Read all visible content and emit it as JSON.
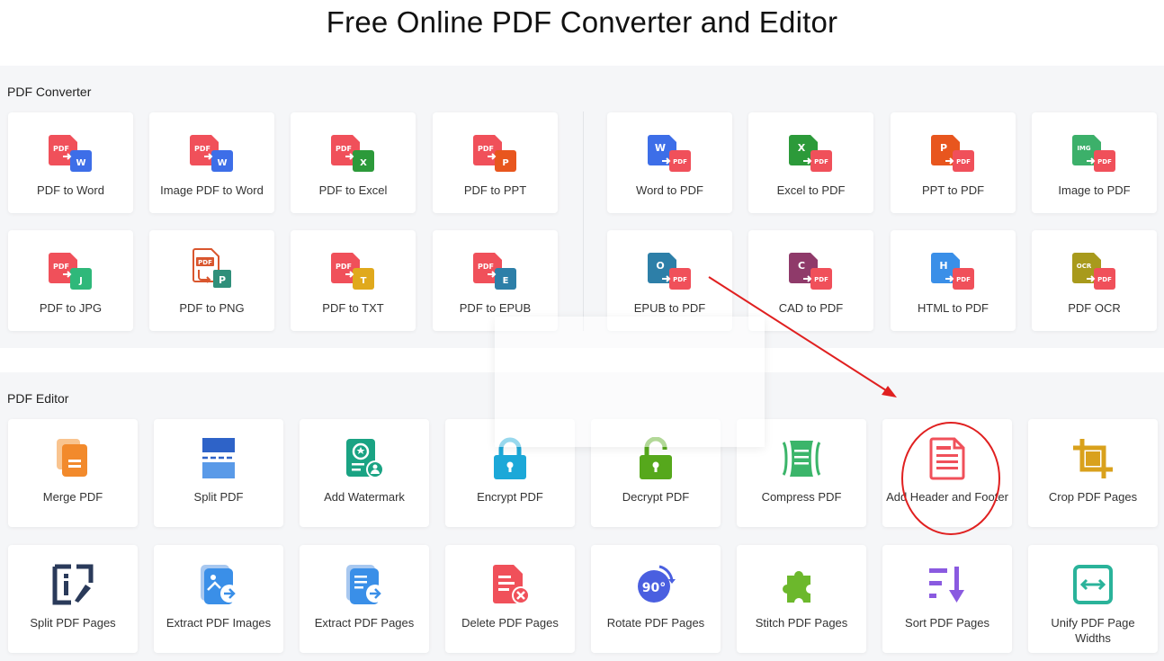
{
  "page": {
    "title": "Free Online PDF Converter and Editor"
  },
  "converter": {
    "section_title": "PDF Converter",
    "tools": [
      {
        "label": "PDF to Word",
        "icon": "pdf-to-word-icon"
      },
      {
        "label": "Image PDF to Word",
        "icon": "image-pdf-to-word-icon"
      },
      {
        "label": "PDF to Excel",
        "icon": "pdf-to-excel-icon"
      },
      {
        "label": "PDF to PPT",
        "icon": "pdf-to-ppt-icon"
      },
      {
        "label": "Word to PDF",
        "icon": "word-to-pdf-icon"
      },
      {
        "label": "Excel to PDF",
        "icon": "excel-to-pdf-icon"
      },
      {
        "label": "PPT to PDF",
        "icon": "ppt-to-pdf-icon"
      },
      {
        "label": "Image to PDF",
        "icon": "image-to-pdf-icon"
      },
      {
        "label": "PDF to JPG",
        "icon": "pdf-to-jpg-icon"
      },
      {
        "label": "PDF to PNG",
        "icon": "pdf-to-png-icon"
      },
      {
        "label": "PDF to TXT",
        "icon": "pdf-to-txt-icon"
      },
      {
        "label": "PDF to EPUB",
        "icon": "pdf-to-epub-icon"
      },
      {
        "label": "EPUB to PDF",
        "icon": "epub-to-pdf-icon"
      },
      {
        "label": "CAD to PDF",
        "icon": "cad-to-pdf-icon"
      },
      {
        "label": "HTML to PDF",
        "icon": "html-to-pdf-icon"
      },
      {
        "label": "PDF OCR",
        "icon": "pdf-ocr-icon"
      }
    ]
  },
  "editor": {
    "section_title": "PDF Editor",
    "tools": [
      {
        "label": "Merge PDF",
        "icon": "merge-pdf-icon"
      },
      {
        "label": "Split PDF",
        "icon": "split-pdf-icon"
      },
      {
        "label": "Add Watermark",
        "icon": "add-watermark-icon"
      },
      {
        "label": "Encrypt PDF",
        "icon": "lock-icon"
      },
      {
        "label": "Decrypt PDF",
        "icon": "unlock-icon"
      },
      {
        "label": "Compress PDF",
        "icon": "compress-pdf-icon"
      },
      {
        "label": "Add Header and Footer",
        "icon": "header-footer-icon"
      },
      {
        "label": "Crop PDF Pages",
        "icon": "crop-icon"
      },
      {
        "label": "Split PDF Pages",
        "icon": "split-pages-icon"
      },
      {
        "label": "Extract PDF Images",
        "icon": "extract-images-icon"
      },
      {
        "label": "Extract PDF Pages",
        "icon": "extract-pages-icon"
      },
      {
        "label": "Delete PDF Pages",
        "icon": "delete-pages-icon"
      },
      {
        "label": "Rotate PDF Pages",
        "icon": "rotate-icon"
      },
      {
        "label": "Stitch PDF Pages",
        "icon": "stitch-puzzle-icon"
      },
      {
        "label": "Sort PDF Pages",
        "icon": "sort-pages-icon"
      },
      {
        "label": "Unify PDF Page Widths",
        "icon": "unify-widths-icon"
      }
    ]
  },
  "icon_glyphs": {
    "pdf": "PDF",
    "word": "W",
    "excel": "X",
    "ppt": "P",
    "img": "IMG",
    "jpg": "J",
    "png": "P",
    "txt": "T",
    "epub": "E",
    "epub_src": "O",
    "cad": "C",
    "html": "H",
    "ocr": "OCR",
    "rotate": "90°"
  },
  "colors": {
    "accent_red": "#f0505a",
    "word_blue": "#3d6ee8",
    "excel_green": "#2c9a3a",
    "ppt_orange": "#e8561e",
    "png_teal": "#2f8f7a",
    "jpg_green": "#2fb87a",
    "txt_yellow": "#e0a91c",
    "epub_teal": "#2d7fa8",
    "cad_purple": "#8f3a6a",
    "html_blue": "#3a8fe8",
    "ocr_olive": "#a89a1c",
    "img_green": "#3cb06a",
    "annotation_red": "#e02020",
    "band_bg": "#f5f6f8"
  }
}
